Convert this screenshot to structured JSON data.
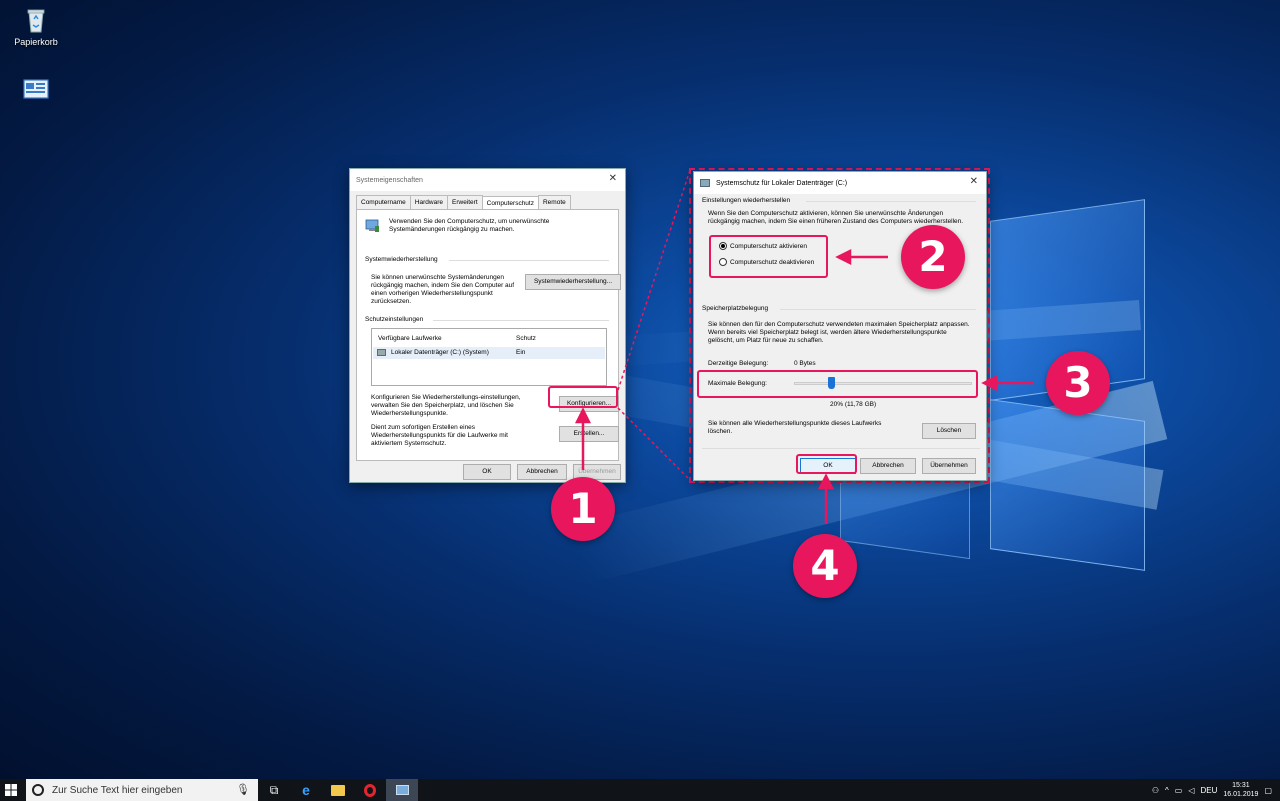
{
  "desktop": {
    "recycle_bin_label": "Papierkorb"
  },
  "sysprops": {
    "title": "Systemeigenschaften",
    "tabs": [
      "Computername",
      "Hardware",
      "Erweitert",
      "Computerschutz",
      "Remote"
    ],
    "intro_text": "Verwenden Sie den Computerschutz, um unerwünschte Systemänderungen rückgängig zu machen.",
    "restore_heading": "Systemwiederherstellung",
    "restore_text": "Sie können unerwünschte Systemänderungen rückgängig machen, indem Sie den Computer auf einen vorherigen Wiederherstellungspunkt zurücksetzen.",
    "restore_button": "Systemwiederherstellung...",
    "protection_heading": "Schutzeinstellungen",
    "table_headers": [
      "Verfügbare Laufwerke",
      "Schutz"
    ],
    "table_rows": [
      [
        "Lokaler Datenträger (C:) (System)",
        "Ein"
      ]
    ],
    "configure_text": "Konfigurieren Sie Wiederherstellungs-einstellungen, verwalten Sie den Speicherplatz, und löschen Sie Wiederherstellungspunkte.",
    "configure_button": "Konfigurieren...",
    "create_text": "Dient zum sofortigen Erstellen eines Wiederherstellungspunkts für die Laufwerke mit aktiviertem Systemschutz.",
    "create_button": "Erstellen...",
    "ok": "OK",
    "cancel": "Abbrechen",
    "apply": "Übernehmen"
  },
  "sysprot": {
    "title": "Systemschutz für Lokaler Datenträger (C:)",
    "restore_heading": "Einstellungen wiederherstellen",
    "restore_text": "Wenn Sie den Computerschutz aktivieren, können Sie unerwünschte Änderungen rückgängig machen, indem Sie einen früheren Zustand des Computers wiederherstellen.",
    "radio_on": "Computerschutz aktivieren",
    "radio_off": "Computerschutz deaktivieren",
    "radio_selected": "Computerschutz aktivieren",
    "disk_heading": "Speicherplatzbelegung",
    "disk_text": "Sie können den für den Computerschutz verwendeten maximalen Speicherplatz anpassen. Wenn bereits viel Speicherplatz belegt ist, werden ältere Wiederherstellungspunkte gelöscht, um Platz für neue zu schaffen.",
    "current_usage_label": "Derzeitige Belegung:",
    "current_usage_value": "0 Bytes",
    "max_usage_label": "Maximale Belegung:",
    "max_usage_fraction": 0.2,
    "max_usage_value": "20% (11,78 GB)",
    "delete_text": "Sie können alle Wiederherstellungspunkte dieses Laufwerks löschen.",
    "delete_button": "Löschen",
    "ok": "OK",
    "cancel": "Abbrechen",
    "apply": "Übernehmen"
  },
  "callouts": [
    "1",
    "2",
    "3",
    "4"
  ],
  "taskbar": {
    "search_placeholder": "Zur Suche Text hier eingeben",
    "language": "DEU",
    "time": "15:31",
    "date": "16.01.2019"
  },
  "colors": {
    "highlight": "#e8175d",
    "taskbar": "#101418"
  }
}
